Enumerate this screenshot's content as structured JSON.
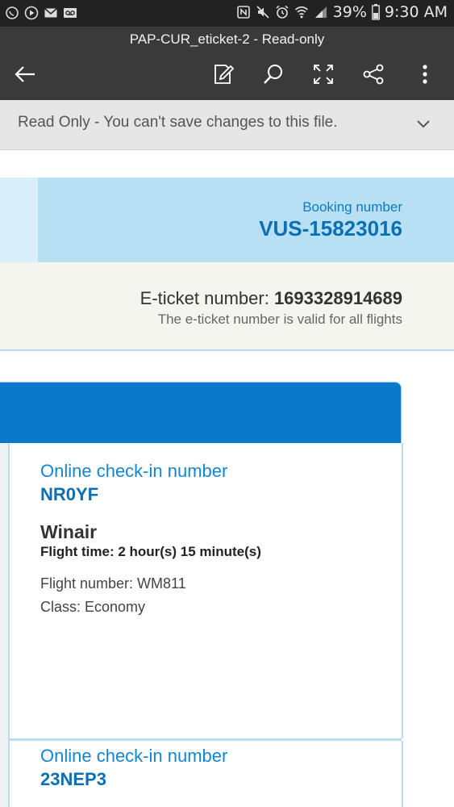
{
  "status_bar": {
    "battery": "39%",
    "time": "9:30 AM",
    "left_icons": [
      "whatsapp-icon",
      "play-icon",
      "mail-icon",
      "voicemail-icon"
    ],
    "right_icons": [
      "nfc-icon",
      "mute-icon",
      "alarm-icon",
      "wifi-icon",
      "signal-icon",
      "battery-icon"
    ]
  },
  "app_bar": {
    "document_title": "PAP-CUR_eticket-2 - Read-only",
    "icons": [
      "back-arrow-icon",
      "edit-icon",
      "search-icon",
      "fullscreen-icon",
      "share-icon",
      "more-icon"
    ]
  },
  "banner": {
    "text": "Read Only - You can't save changes to this file."
  },
  "document": {
    "booking_label": "Booking number",
    "booking_number": "VUS-15823016",
    "eticket_label": "E-ticket number:",
    "eticket_number": "1693328914689",
    "eticket_note": "The e-ticket number is valid for all flights",
    "flights": [
      {
        "checkin_label": "Online check-in number",
        "checkin_code": "NR0YF",
        "airline": "Winair",
        "flight_time": "Flight time: 2 hour(s) 15 minute(s)",
        "flight_number": "Flight number: WM811",
        "class": "Class: Economy"
      },
      {
        "checkin_label": "Online check-in number",
        "checkin_code": "23NEP3"
      }
    ]
  },
  "colors": {
    "status_bar_bg": "#222222",
    "app_bar_bg": "#3a3a3a",
    "banner_bg": "#e6e6e6",
    "booking_bg": "#b8e0f5",
    "accent_blue": "#0a79c7",
    "eticket_bg": "#f5f5f0"
  }
}
